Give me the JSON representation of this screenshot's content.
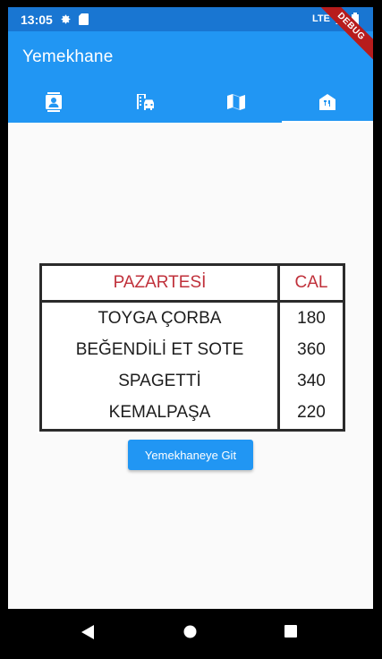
{
  "status_bar": {
    "time": "13:05",
    "network": "LTE",
    "icons": [
      "gear-icon",
      "sd-card-icon",
      "signal-icon",
      "battery-icon"
    ]
  },
  "debug_banner": "DEBUG",
  "app_bar": {
    "title": "Yemekhane",
    "tabs": [
      {
        "icon": "contacts-icon",
        "active": false
      },
      {
        "icon": "transit-icon",
        "active": false
      },
      {
        "icon": "map-icon",
        "active": false
      },
      {
        "icon": "restaurant-icon",
        "active": true
      }
    ]
  },
  "menu": {
    "headers": [
      "PAZARTESİ",
      "CAL"
    ],
    "rows": [
      {
        "dish": "TOYGA ÇORBA",
        "cal": "180"
      },
      {
        "dish": "BEĞENDİLİ ET SOTE",
        "cal": "360"
      },
      {
        "dish": "SPAGETTİ",
        "cal": "340"
      },
      {
        "dish": "KEMALPAŞA",
        "cal": "220"
      }
    ]
  },
  "action_button": "Yemekhaneye Git",
  "nav": [
    "back-icon",
    "home-icon",
    "recents-icon"
  ],
  "colors": {
    "primary": "#2196f3",
    "primary_dark": "#1976d2",
    "header_red": "#c0313b",
    "debug_red": "#b71c1c"
  }
}
